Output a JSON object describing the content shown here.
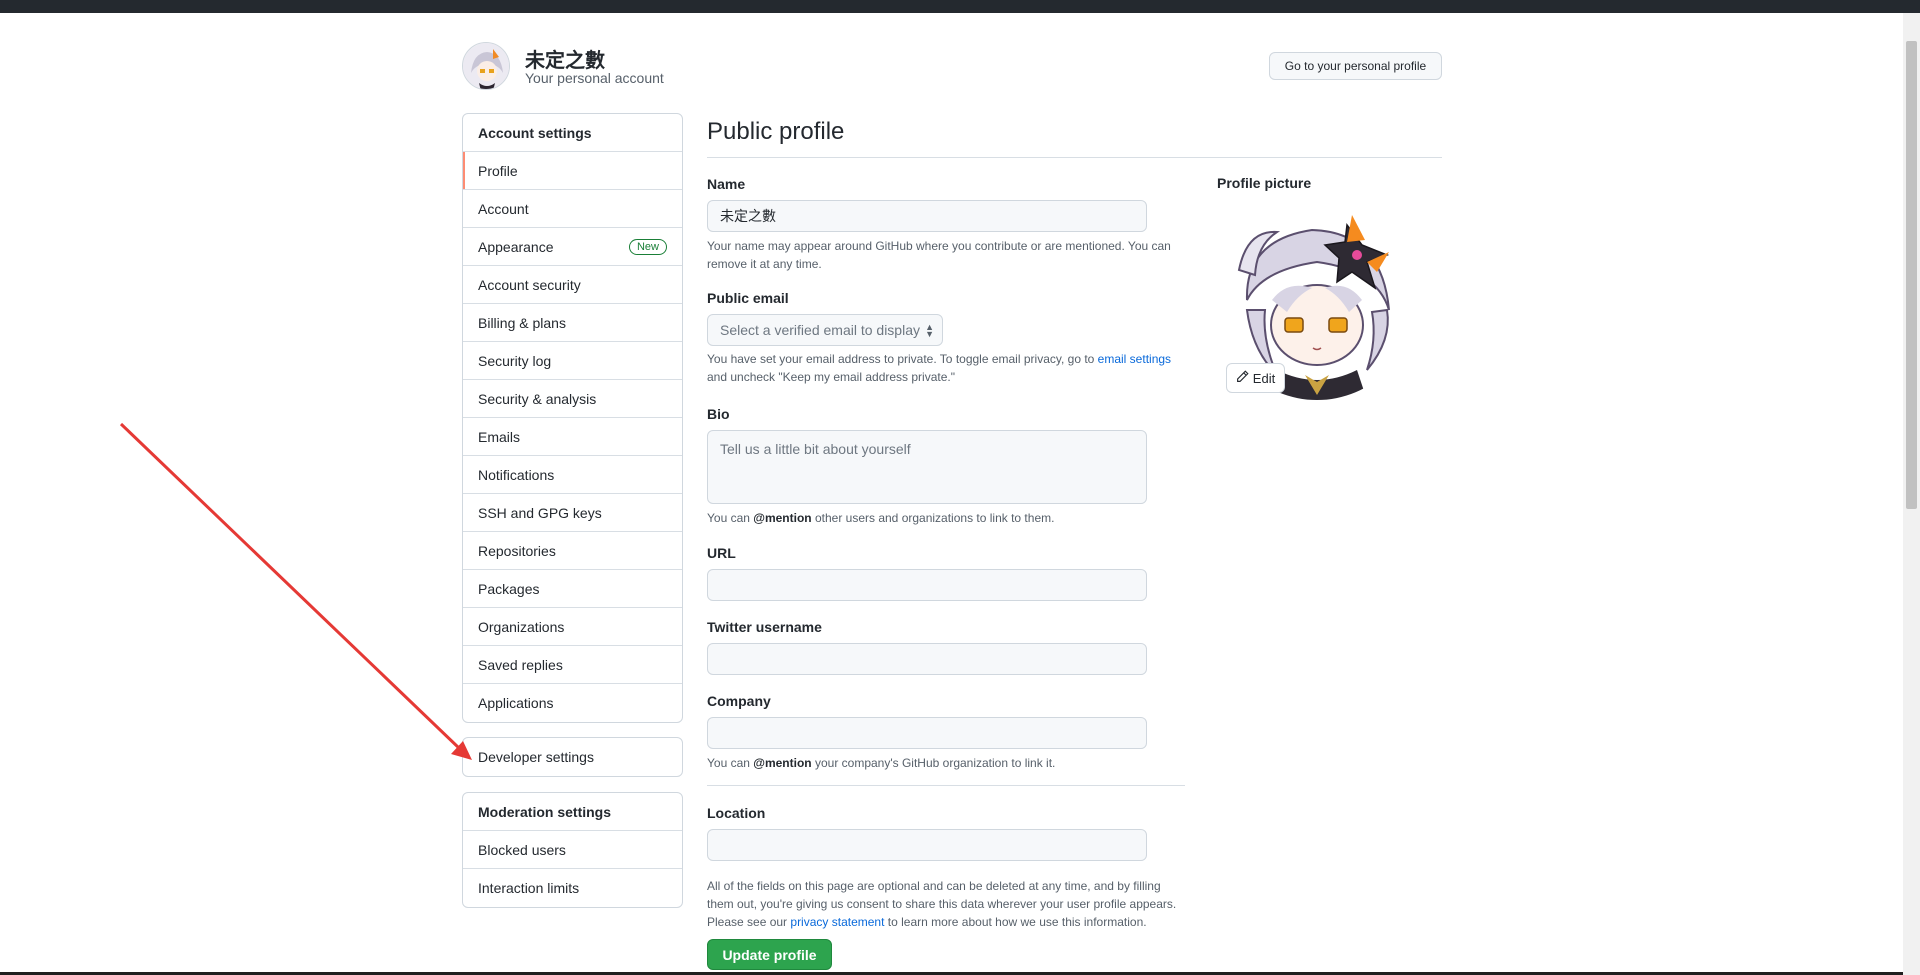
{
  "header": {
    "account_name": "未定之數",
    "account_sub": "Your personal account",
    "personal_profile_button": "Go to your personal profile"
  },
  "sidebar": {
    "account_heading": "Account settings",
    "items": [
      {
        "label": "Profile",
        "selected": true
      },
      {
        "label": "Account"
      },
      {
        "label": "Appearance",
        "badge": "New"
      },
      {
        "label": "Account security"
      },
      {
        "label": "Billing & plans"
      },
      {
        "label": "Security log"
      },
      {
        "label": "Security & analysis"
      },
      {
        "label": "Emails"
      },
      {
        "label": "Notifications"
      },
      {
        "label": "SSH and GPG keys"
      },
      {
        "label": "Repositories"
      },
      {
        "label": "Packages"
      },
      {
        "label": "Organizations"
      },
      {
        "label": "Saved replies"
      },
      {
        "label": "Applications"
      }
    ],
    "developer_settings": "Developer settings",
    "moderation_heading": "Moderation settings",
    "moderation_items": [
      {
        "label": "Blocked users"
      },
      {
        "label": "Interaction limits"
      }
    ]
  },
  "main": {
    "title": "Public profile",
    "name": {
      "label": "Name",
      "value": "未定之數",
      "note": "Your name may appear around GitHub where you contribute or are mentioned. You can remove it at any time."
    },
    "email": {
      "label": "Public email",
      "placeholder": "Select a verified email to display",
      "note_prefix": "You have set your email address to private. To toggle email privacy, go to ",
      "note_link": "email settings",
      "note_suffix": " and uncheck \"Keep my email address private.\""
    },
    "bio": {
      "label": "Bio",
      "placeholder": "Tell us a little bit about yourself",
      "note_prefix": "You can ",
      "note_mention": "@mention",
      "note_suffix": " other users and organizations to link to them."
    },
    "url": {
      "label": "URL",
      "value": ""
    },
    "twitter": {
      "label": "Twitter username",
      "value": ""
    },
    "company": {
      "label": "Company",
      "value": "",
      "note_prefix": "You can ",
      "note_mention": "@mention",
      "note_suffix": " your company's GitHub organization to link it."
    },
    "location": {
      "label": "Location",
      "value": ""
    },
    "footer_note_prefix": "All of the fields on this page are optional and can be deleted at any time, and by filling them out, you're giving us consent to share this data wherever your user profile appears. Please see our ",
    "footer_note_link": "privacy statement",
    "footer_note_suffix": " to learn more about how we use this information.",
    "update_button": "Update profile"
  },
  "profile_picture": {
    "label": "Profile picture",
    "edit_button": "Edit",
    "edit_icon": "pencil-icon"
  },
  "colors": {
    "update_green": "#2da44e",
    "selected_accent": "#fd8c73",
    "link_blue": "#0969da",
    "annotation_red": "#e53935"
  }
}
